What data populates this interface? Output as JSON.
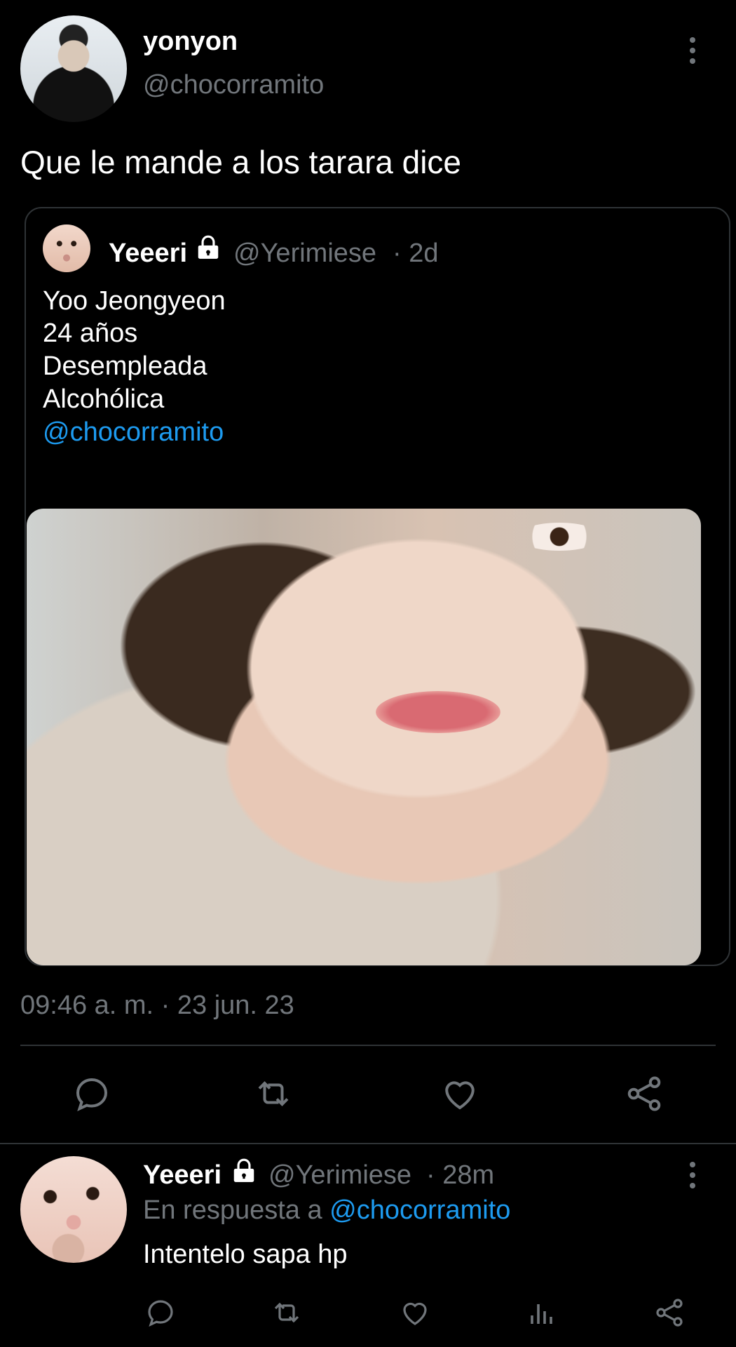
{
  "main_tweet": {
    "author_name": "yonyon",
    "author_handle": "@chocorramito",
    "text": "Que le mande a los tarara dice",
    "timestamp": "09:46 a. m. · 23 jun. 23"
  },
  "quoted_tweet": {
    "author_name": "Yeeeri",
    "author_handle": "@Yerimiese",
    "age": "· 2d",
    "lines": [
      "Yoo Jeongyeon",
      "24 años",
      "Desempleada",
      "Alcohólica"
    ],
    "mention": "@chocorramito"
  },
  "reply": {
    "author_name": "Yeeeri",
    "author_handle": "@Yerimiese",
    "age": "· 28m",
    "replying_to_prefix": "En respuesta a",
    "replying_to_handle": "@chocorramito",
    "text": "Intentelo sapa hp"
  },
  "icons": {
    "more": "more-vertical-icon",
    "lock": "lock-icon",
    "reply": "reply-icon",
    "retweet": "retweet-icon",
    "like": "heart-icon",
    "share": "share-icon",
    "views": "analytics-icon"
  },
  "colors": {
    "background": "#000000",
    "text": "#ffffff",
    "muted": "#71767b",
    "link": "#1d9bf0",
    "border": "#2f3336"
  }
}
